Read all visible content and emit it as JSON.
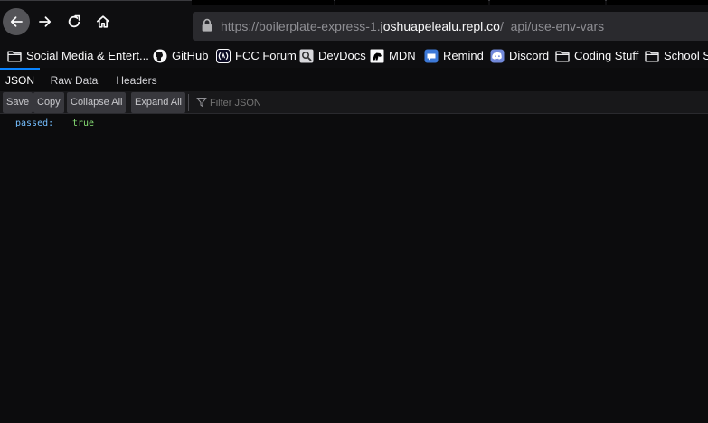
{
  "browser": {
    "url_prefix": "https://boilerplate-express-1.",
    "url_domain": "joshuapelealu.repl.co",
    "url_path": "/_api/use-env-vars"
  },
  "bookmarks": [
    {
      "label": "Social Media & Entert...",
      "icon": "folder-icon"
    },
    {
      "label": "GitHub",
      "icon": "github-icon"
    },
    {
      "label": "FCC Forum",
      "icon": "fcc-icon"
    },
    {
      "label": "DevDocs",
      "icon": "devdocs-icon"
    },
    {
      "label": "MDN",
      "icon": "mdn-icon"
    },
    {
      "label": "Remind",
      "icon": "remind-icon"
    },
    {
      "label": "Discord",
      "icon": "discord-icon"
    },
    {
      "label": "Coding Stuff",
      "icon": "folder-icon"
    },
    {
      "label": "School St",
      "icon": "folder-icon"
    }
  ],
  "viewer_tabs": [
    {
      "label": "JSON",
      "active": true
    },
    {
      "label": "Raw Data",
      "active": false
    },
    {
      "label": "Headers",
      "active": false
    }
  ],
  "toolbar": {
    "save_label": "Save",
    "copy_label": "Copy",
    "collapse_label": "Collapse All",
    "expand_label": "Expand All",
    "filter_placeholder": "Filter JSON"
  },
  "json_rows": [
    {
      "key": "passed:",
      "value": "true"
    }
  ],
  "colors": {
    "background": "#0c0c0d",
    "accent": "#0a84ff",
    "json_key": "#75bfff",
    "json_boolean": "#86de74"
  }
}
